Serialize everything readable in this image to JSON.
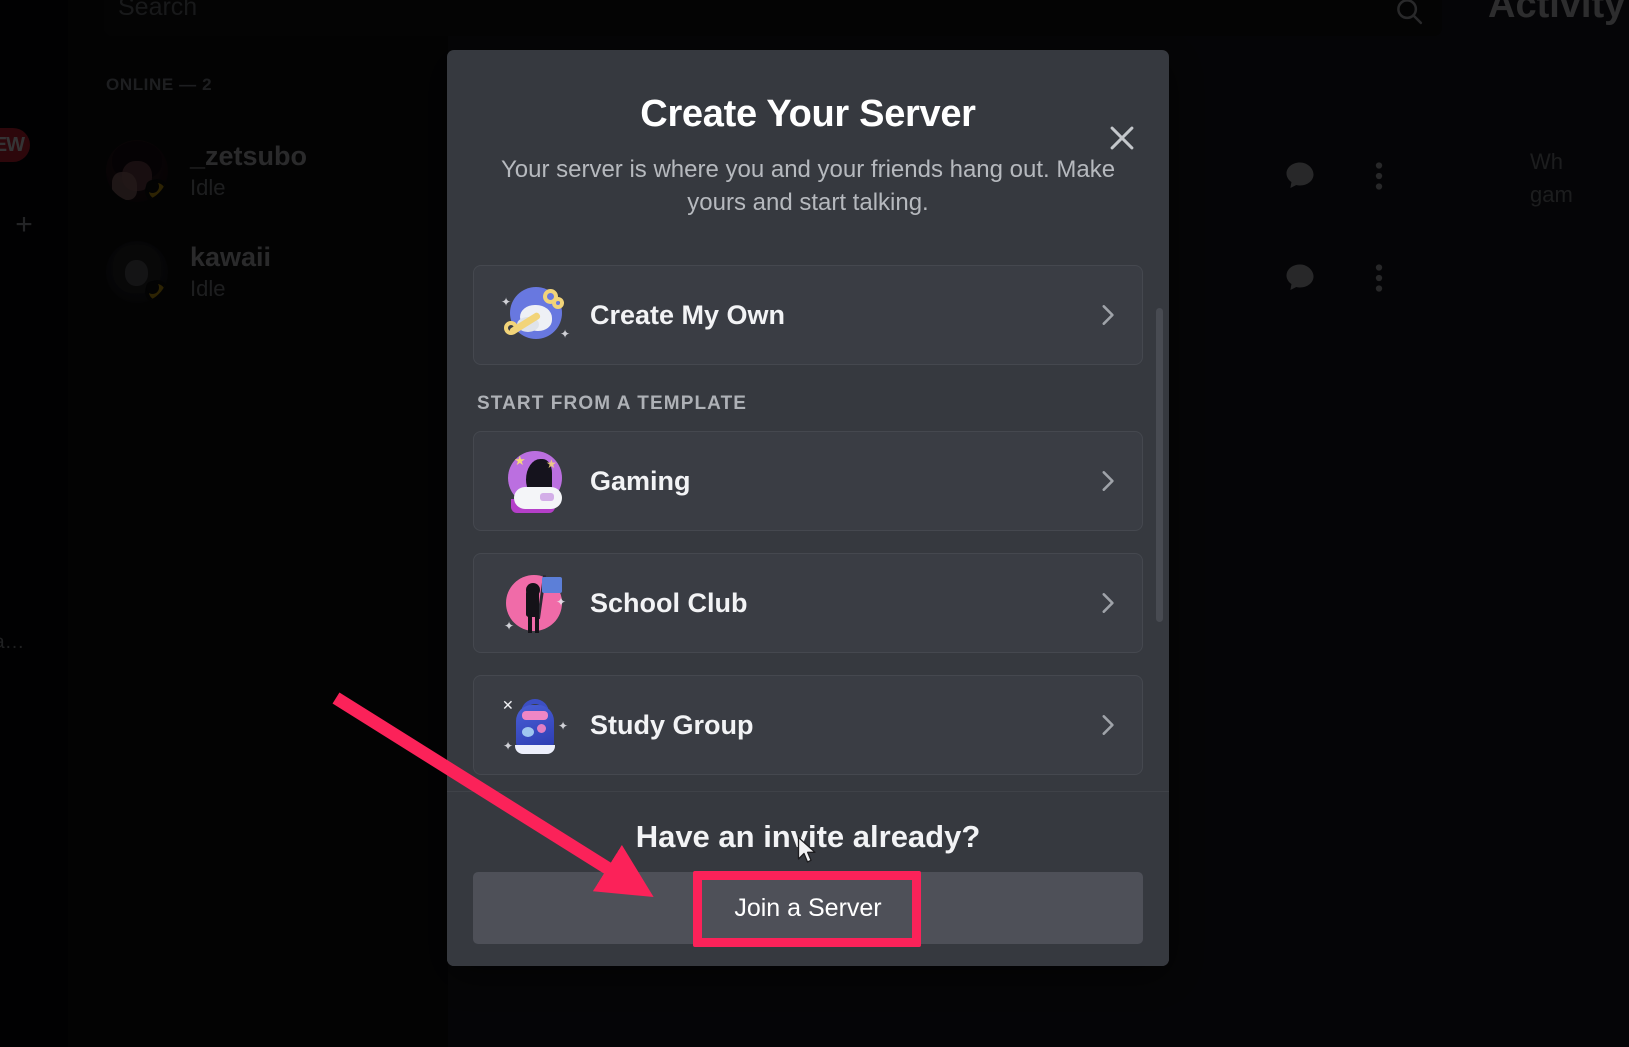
{
  "app": {
    "search": {
      "placeholder": "Search",
      "icon": "search-icon"
    },
    "server_rail": {
      "badge_text": "NEW",
      "add_label": "+",
      "bottom_text": "a..."
    },
    "members": {
      "section_header": "ONLINE — 2",
      "list": [
        {
          "name": "_zetsubo",
          "status": "Idle"
        },
        {
          "name": "kawaii",
          "status": "Idle"
        }
      ]
    },
    "activity": {
      "title": "Activity",
      "blurb_line1": "Wh",
      "blurb_line2": "gam"
    }
  },
  "modal": {
    "title": "Create Your Server",
    "subtitle": "Your server is where you and your friends hang out. Make yours and start talking.",
    "close_label": "✕",
    "primary_option": {
      "label": "Create My Own",
      "icon": "globe-key-icon"
    },
    "template_section_label": "START FROM A TEMPLATE",
    "templates": [
      {
        "label": "Gaming",
        "icon": "gamepad-icon"
      },
      {
        "label": "School Club",
        "icon": "flag-person-icon"
      },
      {
        "label": "Study Group",
        "icon": "backpack-icon"
      }
    ],
    "footer": {
      "invite_heading": "Have an invite already?",
      "join_button_label": "Join a Server"
    }
  },
  "annotation": {
    "highlight_color": "#fb2259",
    "arrow_color": "#fb2259",
    "target": "Join a Server"
  }
}
